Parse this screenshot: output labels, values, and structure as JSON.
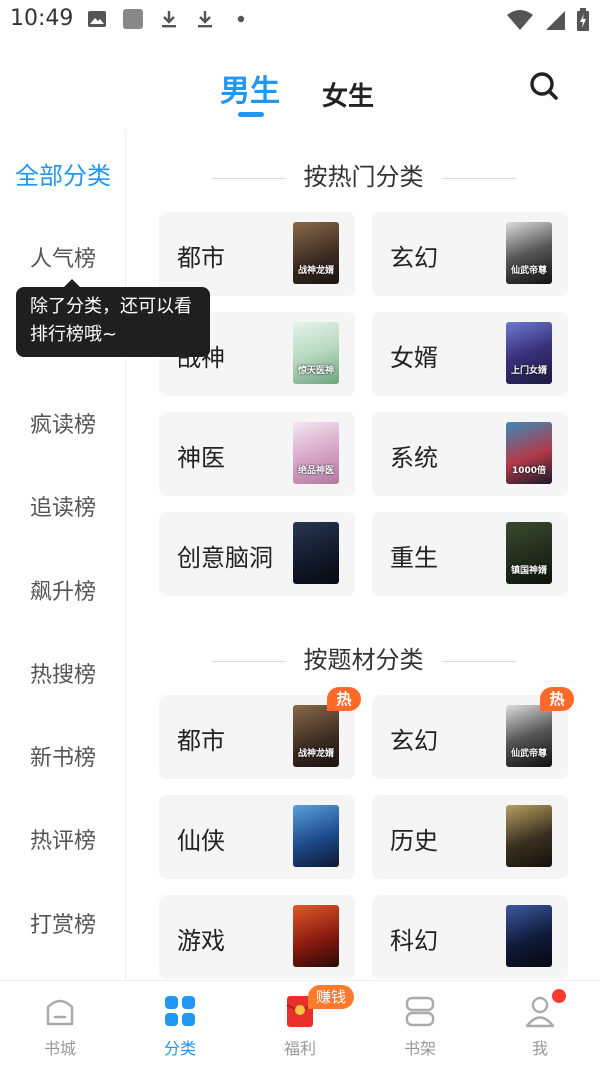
{
  "status_bar": {
    "time": "10:49"
  },
  "header": {
    "tabs": [
      {
        "label": "男生",
        "active": true
      },
      {
        "label": "女生",
        "active": false
      }
    ],
    "search_icon": "search-icon",
    "accent_color": "#2196f3"
  },
  "sidebar": {
    "items": [
      {
        "label": "全部分类",
        "active": true
      },
      {
        "label": "人气榜"
      },
      {
        "label": "疯读榜"
      },
      {
        "label": "追读榜"
      },
      {
        "label": "飙升榜"
      },
      {
        "label": "热搜榜"
      },
      {
        "label": "新书榜"
      },
      {
        "label": "热评榜"
      },
      {
        "label": "打赏榜"
      }
    ],
    "tooltip": "除了分类，还可以看排行榜哦~"
  },
  "sections": [
    {
      "title": "按热门分类",
      "cards": [
        {
          "label": "都市",
          "cover_title": "战神龙婿",
          "hot": false
        },
        {
          "label": "玄幻",
          "cover_title": "仙武帝尊",
          "hot": false
        },
        {
          "label": "战神",
          "cover_title": "惊天医神",
          "hot": false
        },
        {
          "label": "女婿",
          "cover_title": "上门女婿",
          "hot": false
        },
        {
          "label": "神医",
          "cover_title": "绝品神医",
          "hot": false
        },
        {
          "label": "系统",
          "cover_title": "1000倍",
          "hot": false
        },
        {
          "label": "创意脑洞",
          "cover_title": "",
          "hot": false
        },
        {
          "label": "重生",
          "cover_title": "镇国神婿",
          "hot": false
        }
      ]
    },
    {
      "title": "按题材分类",
      "cards": [
        {
          "label": "都市",
          "cover_title": "战神龙婿",
          "hot": true
        },
        {
          "label": "玄幻",
          "cover_title": "仙武帝尊",
          "hot": true
        },
        {
          "label": "仙侠",
          "cover_title": "",
          "hot": false
        },
        {
          "label": "历史",
          "cover_title": "",
          "hot": false
        },
        {
          "label": "游戏",
          "cover_title": "",
          "hot": false
        },
        {
          "label": "科幻",
          "cover_title": "",
          "hot": false
        }
      ]
    }
  ],
  "hot_label": "热",
  "bottom_nav": {
    "items": [
      {
        "label": "书城",
        "icon": "bookstore-icon",
        "active": false
      },
      {
        "label": "分类",
        "icon": "category-icon",
        "active": true
      },
      {
        "label": "福利",
        "icon": "red-envelope-icon",
        "active": false
      },
      {
        "label": "书架",
        "icon": "bookshelf-icon",
        "active": false
      },
      {
        "label": "我",
        "icon": "profile-icon",
        "active": false
      }
    ],
    "earn_badge": "赚钱"
  }
}
